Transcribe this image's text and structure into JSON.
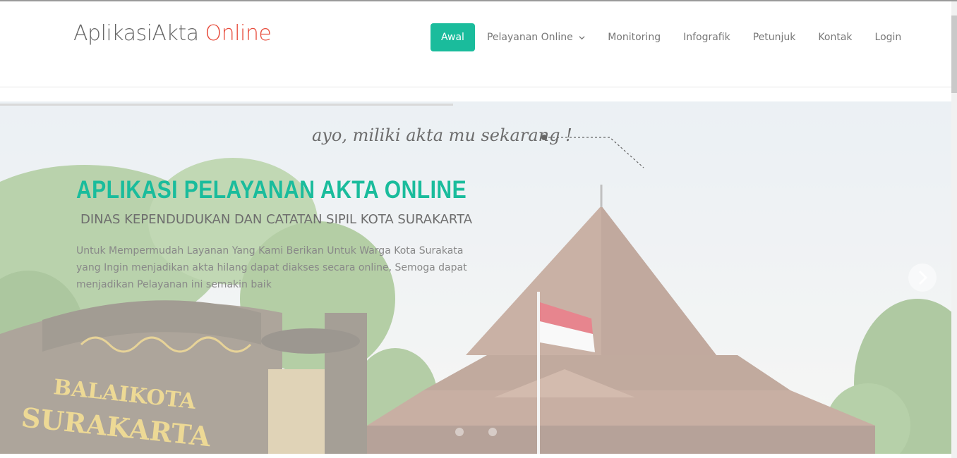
{
  "brand": {
    "name": "AplikasiAkta",
    "accent": "Online",
    "accent_color": "#e74c3c"
  },
  "nav": {
    "items": [
      {
        "label": "Awal",
        "active": true
      },
      {
        "label": "Pelayanan Online",
        "dropdown": true
      },
      {
        "label": "Monitoring"
      },
      {
        "label": "Infografik"
      },
      {
        "label": "Petunjuk"
      },
      {
        "label": "Kontak"
      },
      {
        "label": "Login"
      }
    ],
    "active_color": "#1abc9c"
  },
  "hero": {
    "tagline": "ayo, miliki akta mu sekarang !",
    "title": "APLIKASI PELAYANAN AKTA ONLINE",
    "subtitle": "DINAS KEPENDUDUKAN DAN CATATAN SIPIL KOTA SURAKARTA",
    "description": "Untuk Mempermudah Layanan Yang Kami Berikan Untuk Warga Kota Surakata yang Ingin menjadikan akta hilang dapat diakses secara online, Semoga dapat menjadikan Pelayanan ini semakin baik",
    "sign_line1": "BALAIKOTA",
    "sign_line2": "SURAKARTA",
    "title_color": "#1abc9c"
  }
}
